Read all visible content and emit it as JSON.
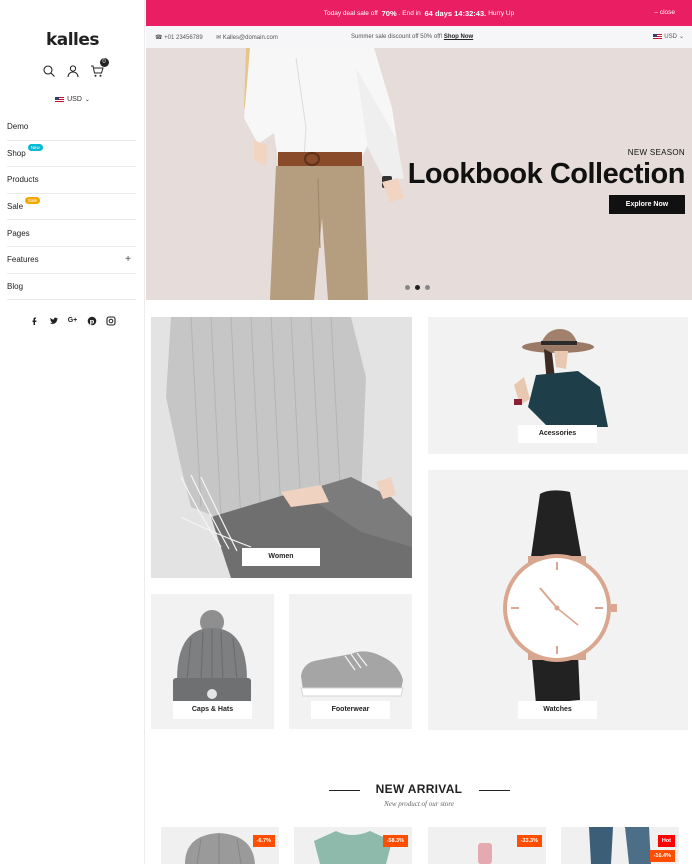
{
  "sidebar": {
    "logo": "kalles",
    "cart_count": "0",
    "currency": "USD",
    "menu": [
      {
        "label": "Demo",
        "badge": ""
      },
      {
        "label": "Shop",
        "badge": "New"
      },
      {
        "label": "Products",
        "badge": ""
      },
      {
        "label": "Sale",
        "badge": "Sale"
      },
      {
        "label": "Pages",
        "badge": ""
      },
      {
        "label": "Features",
        "badge": "",
        "expand": "+"
      },
      {
        "label": "Blog",
        "badge": ""
      }
    ],
    "social_icons": [
      "facebook-icon",
      "twitter-icon",
      "google-plus-icon",
      "pinterest-icon",
      "instagram-icon"
    ]
  },
  "promo": {
    "text_before": "Today deal sale off",
    "percent": "70%",
    "text_mid": ". End in",
    "countdown": "64 days 14:32:43.",
    "text_after": "Hurry Up",
    "close": "close"
  },
  "topbar": {
    "phone": "+01 23456789",
    "email": "Kalles@domain.com",
    "message": "Summer sale discount off 50% off!",
    "message_link": "Shop Now",
    "currency": "USD"
  },
  "hero": {
    "season": "NEW SEASON",
    "title": "Lookbook Collection",
    "button": "Explore Now",
    "slides": 3,
    "active_slide": 2
  },
  "categories": {
    "women": "Women",
    "accessories": "Acessories",
    "caps": "Caps & Hats",
    "footwear": "Footerwear",
    "watches": "Watches"
  },
  "new_arrival": {
    "title": "NEW ARRIVAL",
    "subtitle": "New product of our store",
    "products": [
      {
        "badge": "-6.7%",
        "badge_color": "#ff4e00"
      },
      {
        "badge": "-58.3%",
        "badge_color": "#ff4e00"
      },
      {
        "badge": "-33.3%",
        "badge_color": "#ff4e00"
      },
      {
        "badge": "Hot",
        "badge2": "-16.4%",
        "badge_color": "#ff4e00",
        "hot_color": "#fe0000"
      }
    ]
  },
  "colors": {
    "promo_bg": "#e91e63",
    "new_badge": "#01bad4",
    "sale_badge": "#f6a600"
  }
}
